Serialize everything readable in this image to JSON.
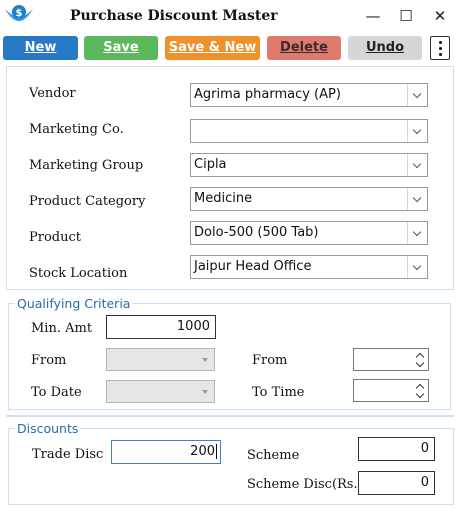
{
  "window": {
    "title": "Purchase Discount Master",
    "controls": {
      "minimize": "—",
      "maximize": "☐",
      "close": "✕"
    }
  },
  "toolbar": {
    "new_label": "New",
    "save_label": "Save",
    "save_new_label": "Save & New",
    "delete_label": "Delete",
    "undo_label": "Undo",
    "colors": {
      "new": "#2878c8",
      "save": "#5cb85c",
      "save_new": "#f0902a",
      "delete": "#e07a6e",
      "undo": "#d6d6d6"
    }
  },
  "form": {
    "vendor": {
      "label": "Vendor",
      "value": "Agrima pharmacy (AP)"
    },
    "marketing_co": {
      "label": "Marketing Co.",
      "value": ""
    },
    "marketing_group": {
      "label": "Marketing Group",
      "value": "Cipla"
    },
    "product_category": {
      "label": "Product Category",
      "value": "Medicine"
    },
    "product": {
      "label": "Product",
      "value": "Dolo-500 (500 Tab)"
    },
    "stock_location": {
      "label": "Stock Location",
      "value": "Jaipur Head Office"
    }
  },
  "qualifying_criteria": {
    "legend": "Qualifying Criteria",
    "min_amt": {
      "label": "Min. Amt",
      "value": "1000"
    },
    "from_date": {
      "label": "From",
      "value": ""
    },
    "to_date": {
      "label": "To Date",
      "value": ""
    },
    "from_time": {
      "label": "From",
      "value": ""
    },
    "to_time": {
      "label": "To Time",
      "value": ""
    }
  },
  "discounts": {
    "legend": "Discounts",
    "trade_disc": {
      "label": "Trade Disc",
      "value": "200"
    },
    "scheme": {
      "label": "Scheme",
      "value": "0"
    },
    "scheme_disc": {
      "label": "Scheme Disc(Rs.)",
      "value": "0"
    }
  },
  "accent_color": "#2a6ab0"
}
